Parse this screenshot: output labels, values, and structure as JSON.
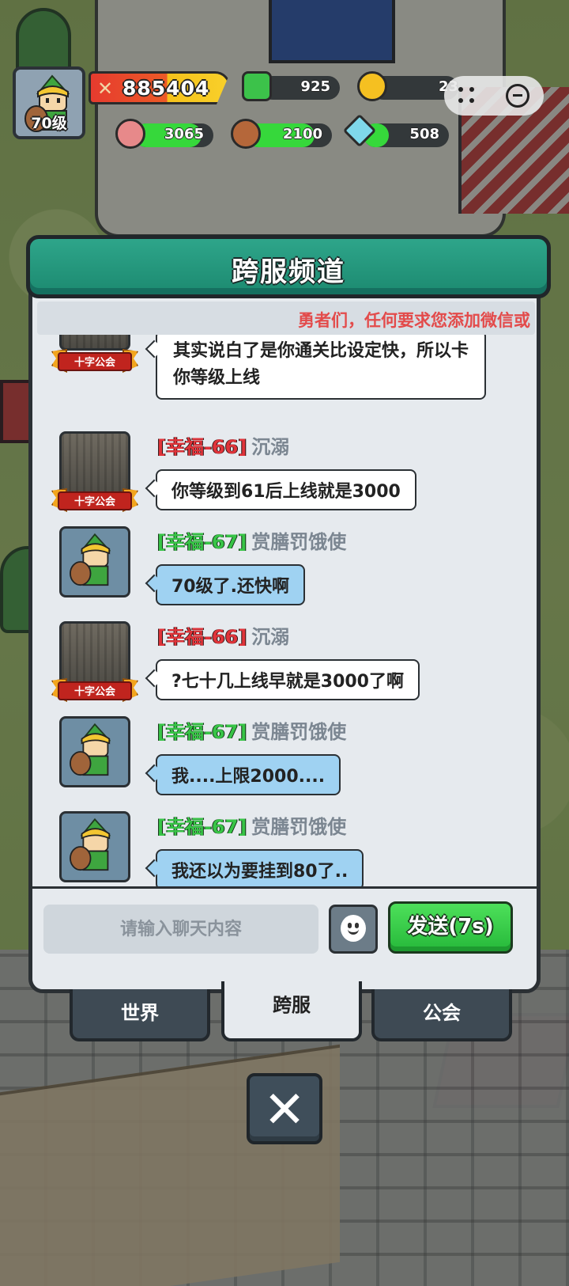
{
  "hud": {
    "level": "70级",
    "power": "885404",
    "gems": "925",
    "coins": "23",
    "meat": "3065",
    "wood": "2100",
    "crystal": "508",
    "meat_fill": 0.85,
    "wood_fill": 0.8,
    "crystal_fill": 0.3
  },
  "panel": {
    "title": "跨服频道",
    "marquee": "勇者们，任何要求您添加微信或"
  },
  "messages": [
    {
      "tag": "",
      "name": "",
      "text1": "其实说白了是你通关比设定快，所以卡",
      "text2": "你等级上线",
      "guild": "十字公会"
    },
    {
      "tag": "[幸福-66]",
      "name": "沉溺",
      "text": "你等级到61后上线就是3000",
      "guild": "十字公会"
    },
    {
      "tag": "[幸福-67]",
      "name": "赏膳罚饿使",
      "text": "70级了.还快啊"
    },
    {
      "tag": "[幸福-66]",
      "name": "沉溺",
      "text": "?七十几上线早就是3000了啊",
      "guild": "十字公会"
    },
    {
      "tag": "[幸福-67]",
      "name": "赏膳罚饿使",
      "text": "我....上限2000...."
    },
    {
      "tag": "[幸福-67]",
      "name": "赏膳罚饿使",
      "text": "我还以为要挂到80了.."
    }
  ],
  "input": {
    "placeholder": "请输入聊天内容",
    "send_label": "发送(7s)"
  },
  "tabs": {
    "world": "世界",
    "cross": "跨服",
    "guild": "公会"
  },
  "colors": {
    "header": "#1c8a70",
    "tag_red": "#e0343a",
    "tag_green": "#38c447",
    "bubble_blue": "#9fd2f2",
    "send_green": "#26b83a"
  }
}
